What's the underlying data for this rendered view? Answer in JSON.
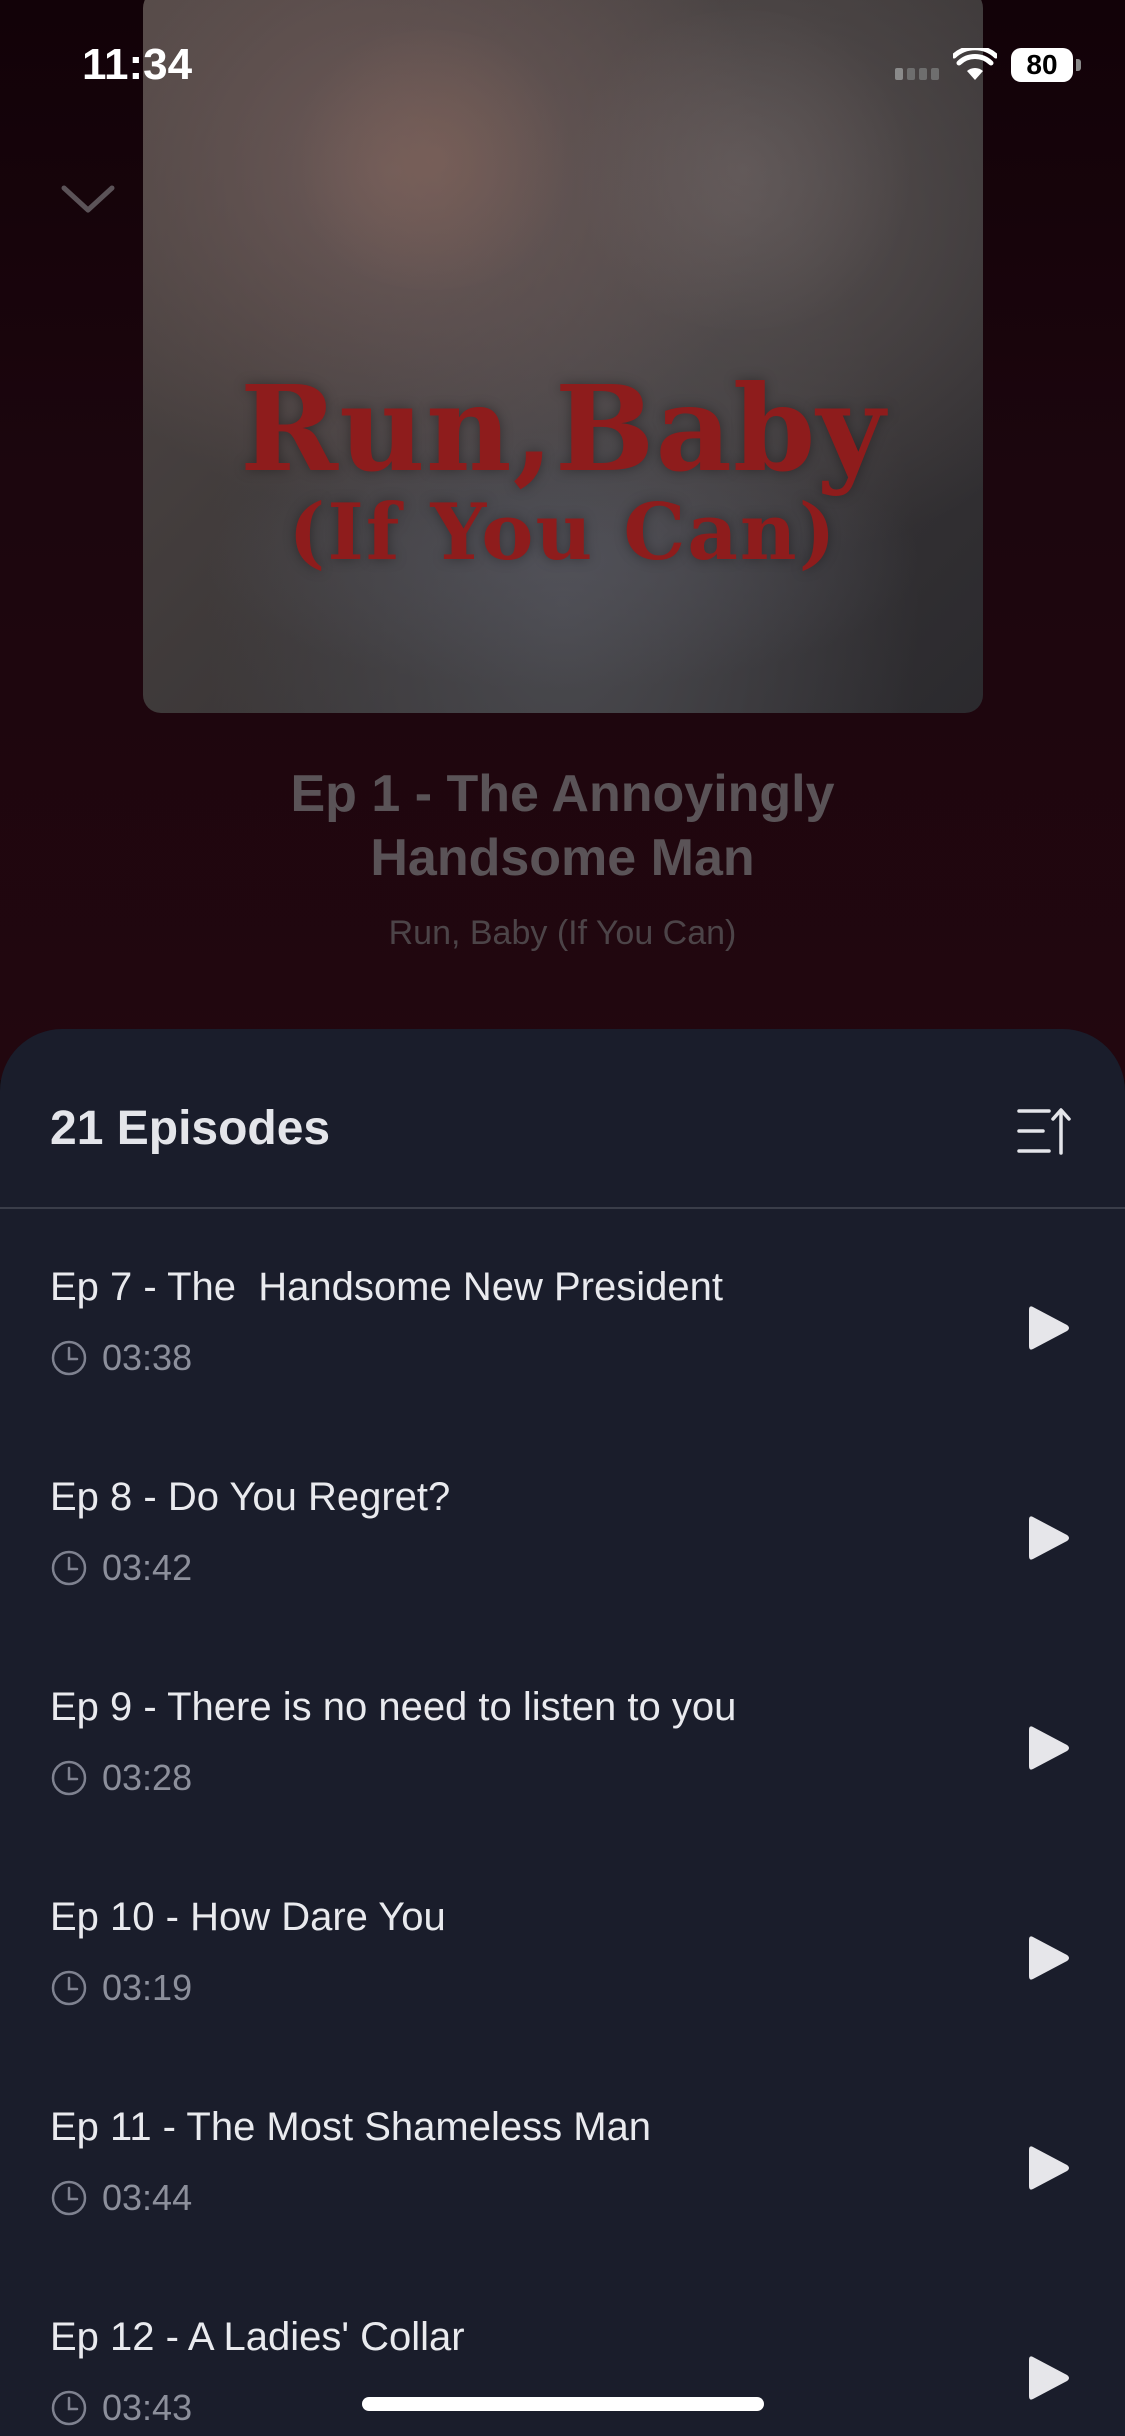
{
  "status_bar": {
    "time": "11:34",
    "battery": "80"
  },
  "cover": {
    "title_line1": "Run,Baby",
    "title_line2": "(If You Can)"
  },
  "now_playing": {
    "episode_title": "Ep 1 - The Annoyingly Handsome Man",
    "series_name": "Run, Baby (If You Can)"
  },
  "episodes_sheet": {
    "count_label": "21 Episodes",
    "episodes": [
      {
        "title": "Ep 7 - The  Handsome New President",
        "duration": "03:38"
      },
      {
        "title": "Ep 8 - Do You Regret?",
        "duration": "03:42"
      },
      {
        "title": "Ep 9 - There is no need to listen to you",
        "duration": "03:28"
      },
      {
        "title": "Ep 10 - How Dare You",
        "duration": "03:19"
      },
      {
        "title": "Ep 11 - The Most Shameless Man",
        "duration": "03:44"
      },
      {
        "title": "Ep 12 - A Ladies' Collar",
        "duration": "03:43"
      }
    ]
  },
  "icons": {
    "collapse": "chevron-down-icon",
    "sort": "sort-order-icon",
    "duration": "clock-icon",
    "play": "play-icon"
  },
  "colors": {
    "sheet_background": "#1a1d2b",
    "divider": "#3a3d49",
    "text_primary": "#e9eaee",
    "text_secondary": "#8c8f9b",
    "cover_title": "#8e1c1c"
  }
}
